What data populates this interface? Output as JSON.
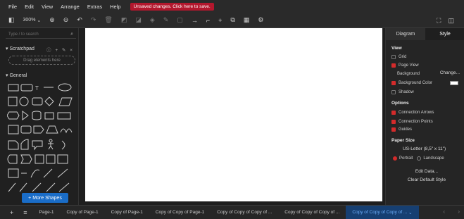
{
  "menu": {
    "items": [
      "File",
      "Edit",
      "View",
      "Arrange",
      "Extras",
      "Help"
    ],
    "unsaved": "Unsaved changes. Click here to save."
  },
  "toolbar": {
    "zoom": "300%"
  },
  "left": {
    "search_placeholder": "Type / to search",
    "scratchpad_label": "Scratchpad",
    "dropzone": "Drag elements here",
    "general_label": "General",
    "more_shapes": "+ More Shapes"
  },
  "right": {
    "tabs": [
      "Diagram",
      "Style"
    ],
    "view_label": "View",
    "grid": "Grid",
    "page_view": "Page View",
    "background": "Background",
    "change": "Change...",
    "background_color": "Background Color",
    "shadow": "Shadow",
    "options_label": "Options",
    "connection_arrows": "Connection Arrows",
    "connection_points": "Connection Points",
    "guides": "Guides",
    "paper_size_label": "Paper Size",
    "paper_size": "US-Letter (8,5\" x 11\")",
    "portrait": "Portrait",
    "landscape": "Landscape",
    "edit_data": "Edit Data...",
    "clear_default_style": "Clear Default Style"
  },
  "pages": {
    "tabs": [
      "Page-1",
      "Copy of Page-1",
      "Copy of Page-1",
      "Copy of Copy of Page-1",
      "Copy of Copy of Copy of ...",
      "Copy of Copy of Copy of ...",
      "Copy of Copy of Copy of ..."
    ]
  },
  "colors": {
    "accent": "#1a6dc8",
    "unsaved": "#b3172d",
    "checkbox": "#d42b2b"
  }
}
